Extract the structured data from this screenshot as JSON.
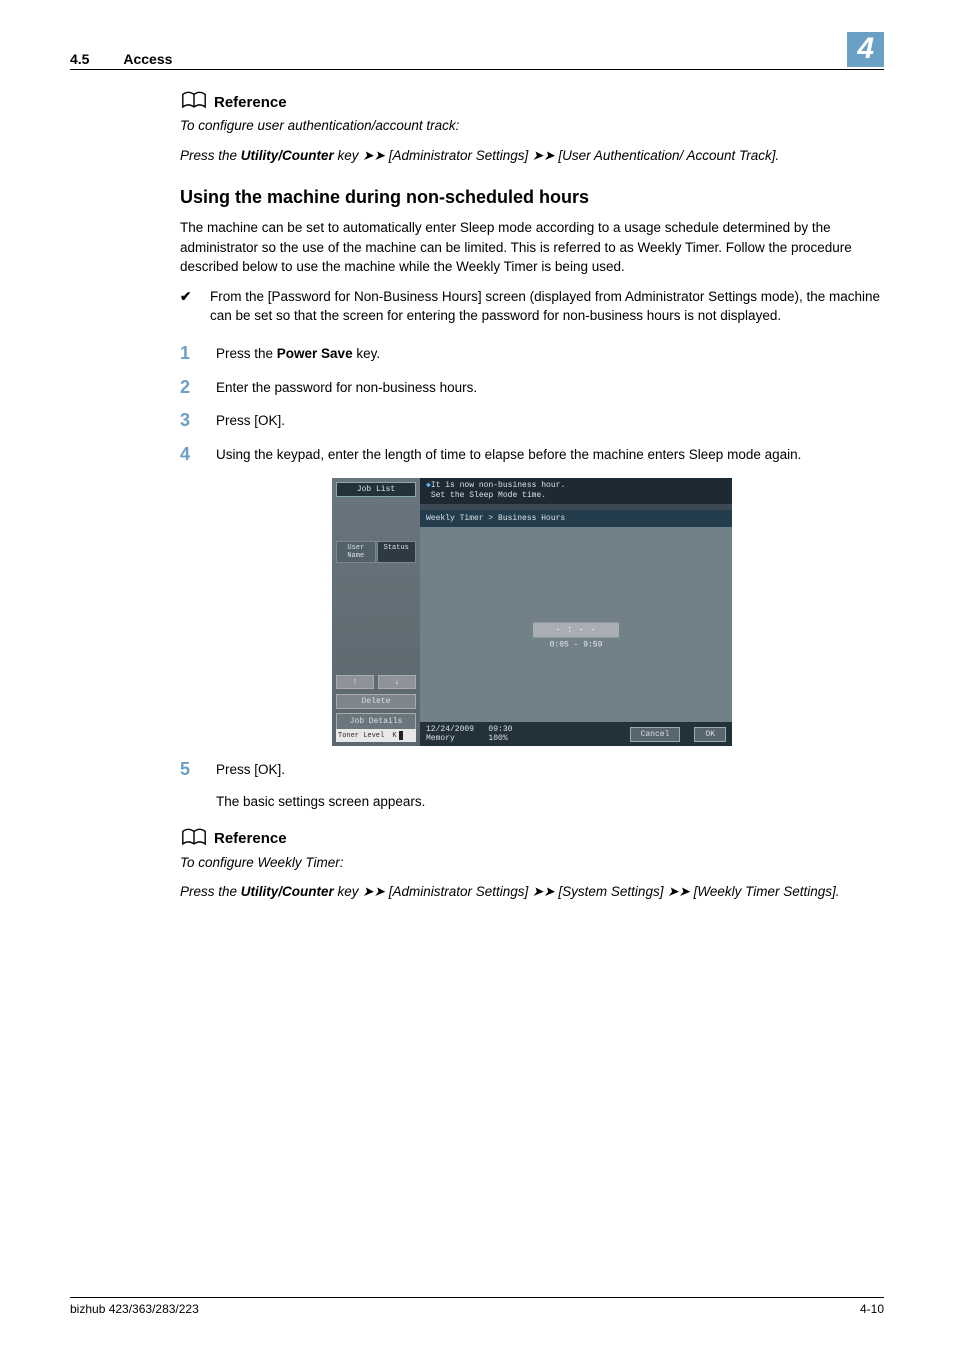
{
  "header": {
    "section_num": "4.5",
    "section_title": "Access",
    "chapter_num": "4"
  },
  "ref1": {
    "label": "Reference",
    "line1": "To configure user authentication/account track:",
    "line2_pre": "Press the ",
    "line2_key": "Utility/Counter",
    "line2_mid": " key ",
    "line2_b1": "[Administrator Settings]",
    "line2_b2": "[User Authentication/ Account Track]."
  },
  "h2": "Using the machine during non-scheduled hours",
  "para1": "The machine can be set to automatically enter Sleep mode according to a usage schedule determined by the administrator so the use of the machine can be limited. This is referred to as Weekly Timer. Follow the procedure described below to use the machine while the Weekly Timer is being used.",
  "check1": "From the [Password for Non-Business Hours] screen (displayed from Administrator Settings mode), the machine can be set so that the screen for entering the password for non-business hours is not displayed.",
  "steps": {
    "s1_num": "1",
    "s1_pre": "Press the ",
    "s1_key": "Power Save",
    "s1_post": " key.",
    "s2_num": "2",
    "s2": "Enter the password for non-business hours.",
    "s3_num": "3",
    "s3": "Press [OK].",
    "s4_num": "4",
    "s4": "Using the keypad, enter the length of time to elapse before the machine enters Sleep mode again.",
    "s5_num": "5",
    "s5": "Press [OK].",
    "s5_sub": "The basic settings screen appears."
  },
  "device": {
    "job_list": "Job List",
    "head_l1": "It is now non-business hour.",
    "head_l2": "Set the Sleep Mode time.",
    "crumb": "Weekly Timer > Business Hours",
    "tab_user": "User Name",
    "tab_status": "Status",
    "arrow_up": "↑",
    "arrow_dn": "↓",
    "delete": "Delete",
    "job_details": "Job Details",
    "toner": "Toner Level",
    "toner_k": "K",
    "input_val": "- : - -",
    "range": "0:05  -  9:59",
    "date": "12/24/2009",
    "time": "09:30",
    "mem_lbl": "Memory",
    "mem_val": "100%",
    "cancel": "Cancel",
    "ok": "OK"
  },
  "ref2": {
    "label": "Reference",
    "line1": "To configure Weekly Timer:",
    "line2_pre": "Press the ",
    "line2_key": "Utility/Counter",
    "line2_mid": " key ",
    "line2_b1": "[Administrator Settings]",
    "line2_b2": "[System Settings]",
    "line2_b3": "[Weekly Timer Settings]."
  },
  "footer": {
    "left": "bizhub 423/363/283/223",
    "right": "4-10"
  },
  "glyphs": {
    "arrows": "➤➤",
    "check": "✔"
  }
}
